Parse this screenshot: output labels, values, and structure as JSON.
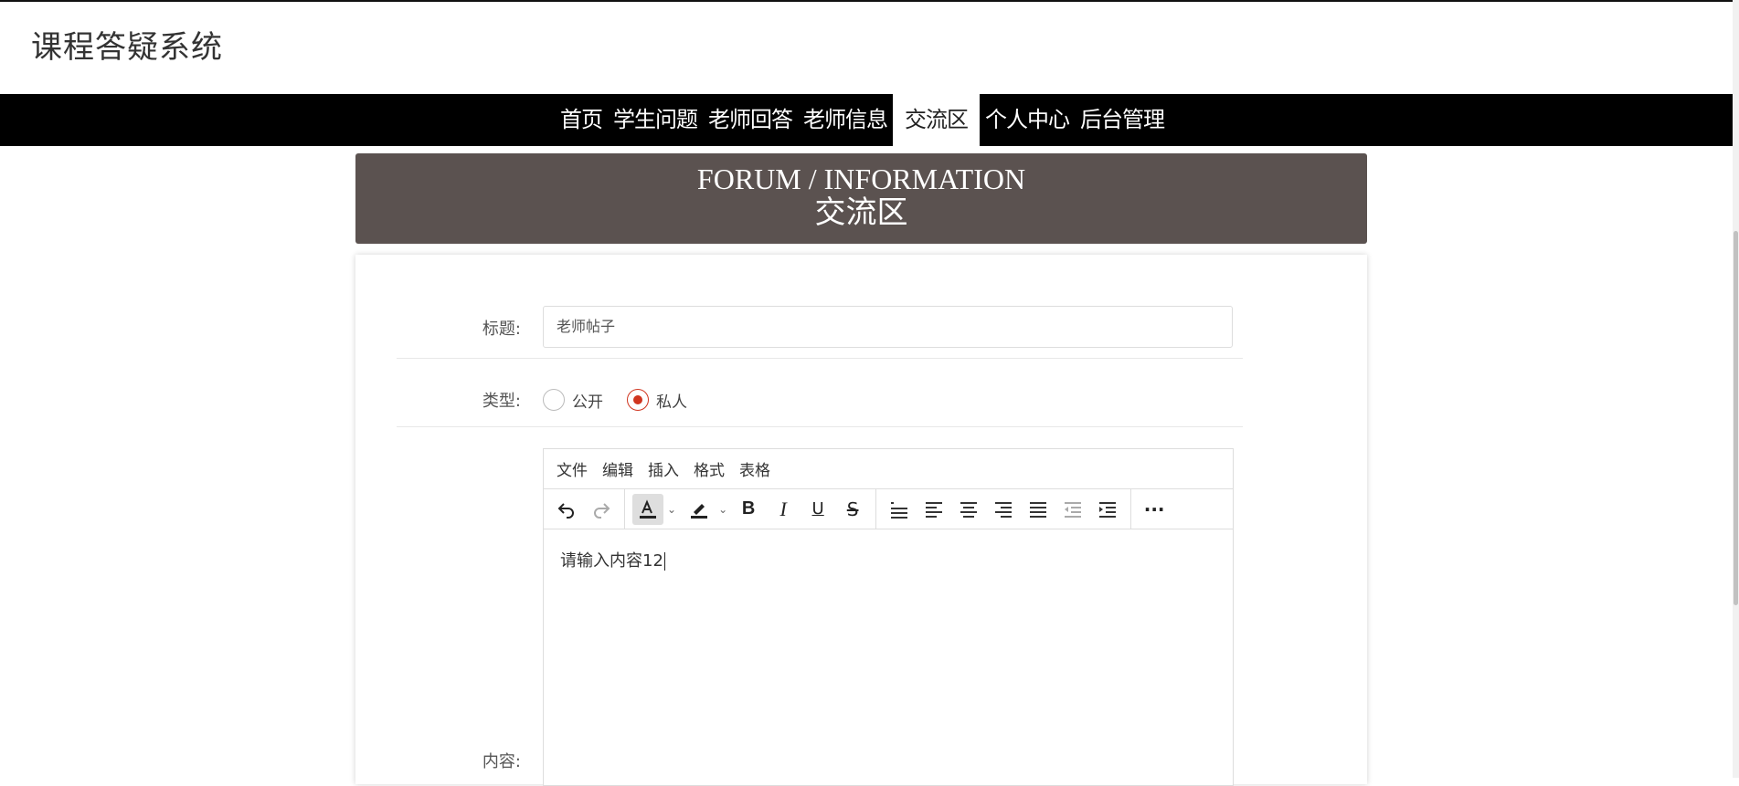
{
  "app": {
    "title": "课程答疑系统"
  },
  "nav": {
    "items": [
      {
        "label": "首页",
        "active": false
      },
      {
        "label": "学生问题",
        "active": false
      },
      {
        "label": "老师回答",
        "active": false
      },
      {
        "label": "老师信息",
        "active": false
      },
      {
        "label": "交流区",
        "active": true
      },
      {
        "label": "个人中心",
        "active": false
      },
      {
        "label": "后台管理",
        "active": false
      }
    ]
  },
  "banner": {
    "title_en": "FORUM / INFORMATION",
    "title_cn": "交流区"
  },
  "form": {
    "title_label": "标题:",
    "title_value": "老师帖子",
    "type_label": "类型:",
    "type_options": [
      {
        "label": "公开",
        "checked": false
      },
      {
        "label": "私人",
        "checked": true
      }
    ],
    "content_label": "内容:"
  },
  "editor": {
    "menus": [
      "文件",
      "编辑",
      "插入",
      "格式",
      "表格"
    ],
    "toolbar": {
      "undo": "undo-icon",
      "redo": "redo-icon",
      "text_color": "text-color-icon",
      "highlight": "highlight-icon",
      "bold": "B",
      "italic": "I",
      "underline": "U",
      "strike": "S",
      "more": "···"
    },
    "content": "请输入内容12"
  }
}
